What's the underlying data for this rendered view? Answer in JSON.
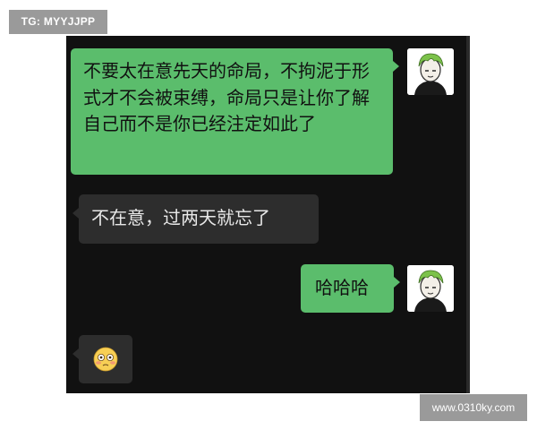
{
  "tag": {
    "text": "TG: MYYJJPP"
  },
  "watermark": {
    "text": "www.0310ky.com"
  },
  "chat": {
    "messages": [
      {
        "side": "right",
        "text": "不要太在意先天的命局，不拘泥于形式才不会被束缚，命局只是让你了解自己而不是你已经注定如此了"
      },
      {
        "side": "left",
        "text": "不在意，过两天就忘了"
      },
      {
        "side": "right",
        "text": "哈哈哈"
      },
      {
        "side": "left",
        "emoji": "flushed-face"
      }
    ]
  },
  "colors": {
    "chat_background": "#111111",
    "sent_bubble": "#5bbd6c",
    "received_bubble": "#2d2d2d",
    "avatar_hair": "#7cc24a"
  }
}
